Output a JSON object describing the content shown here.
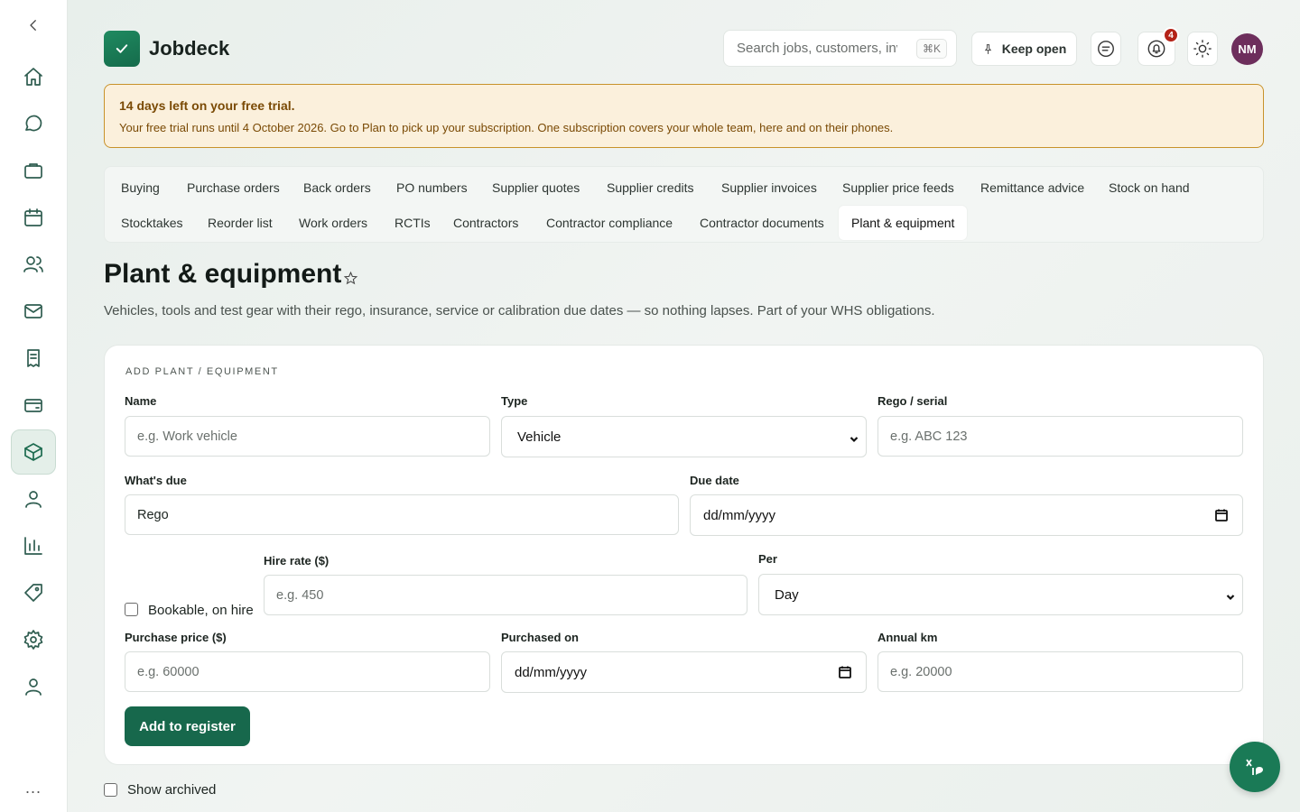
{
  "app": {
    "name": "Jobdeck"
  },
  "header": {
    "search_placeholder": "Search jobs, customers, inv",
    "search_shortcut": "⌘K",
    "keep_open_label": "Keep open",
    "notification_count": "4",
    "avatar_initials": "NM"
  },
  "trial": {
    "title": "14 days left on your free trial.",
    "text": "Your free trial runs until 4 October 2026. Go to Plan to pick up your subscription. One subscription covers your whole team, here and on their phones."
  },
  "tabs": [
    "Buying",
    "Purchase orders",
    "Back orders",
    "PO numbers",
    "Supplier quotes",
    "Supplier credits",
    "Supplier invoices",
    "Supplier price feeds",
    "Remittance advice",
    "Stock on hand",
    "Stocktakes",
    "Reorder list",
    "Work orders",
    "RCTIs",
    "Contractors",
    "Contractor compliance",
    "Contractor documents",
    "Plant & equipment"
  ],
  "active_tab": "Plant & equipment",
  "page": {
    "title": "Plant & equipment",
    "subtitle": "Vehicles, tools and test gear with their rego, insurance, service or calibration due dates — so nothing lapses. Part of your WHS obligations."
  },
  "form": {
    "heading": "ADD PLANT / EQUIPMENT",
    "name_label": "Name",
    "name_placeholder": "e.g. Work vehicle",
    "type_label": "Type",
    "type_value": "Vehicle",
    "rego_label": "Rego / serial",
    "rego_placeholder": "e.g. ABC 123",
    "whats_due_label": "What's due",
    "whats_due_value": "Rego",
    "due_date_label": "Due date",
    "due_date_value": "dd/mm/yyyy",
    "bookable_label": "Bookable, on hire",
    "hire_rate_label": "Hire rate ($)",
    "hire_rate_placeholder": "e.g. 450",
    "per_label": "Per",
    "per_value": "Day",
    "purchase_price_label": "Purchase price ($)",
    "purchase_price_placeholder": "e.g. 60000",
    "purchased_on_label": "Purchased on",
    "purchased_on_value": "dd/mm/yyyy",
    "annual_km_label": "Annual km",
    "annual_km_placeholder": "e.g. 20000",
    "submit_label": "Add to register"
  },
  "show_archived_label": "Show archived",
  "sidebar": {
    "items": [
      "home-icon",
      "chat-icon",
      "briefcase-icon",
      "calendar-icon",
      "users-icon",
      "mail-icon",
      "receipt-icon",
      "wallet-icon",
      "box-icon",
      "person-icon",
      "bar-chart-icon",
      "tag-icon",
      "settings-icon",
      "account-icon"
    ],
    "active": "box-icon",
    "more_label": "..."
  },
  "colors": {
    "brand": "#17684c",
    "banner_bg": "#fbf0dc",
    "banner_border": "#c8922a",
    "badge": "#b42318",
    "avatar": "#6d2e5c"
  }
}
